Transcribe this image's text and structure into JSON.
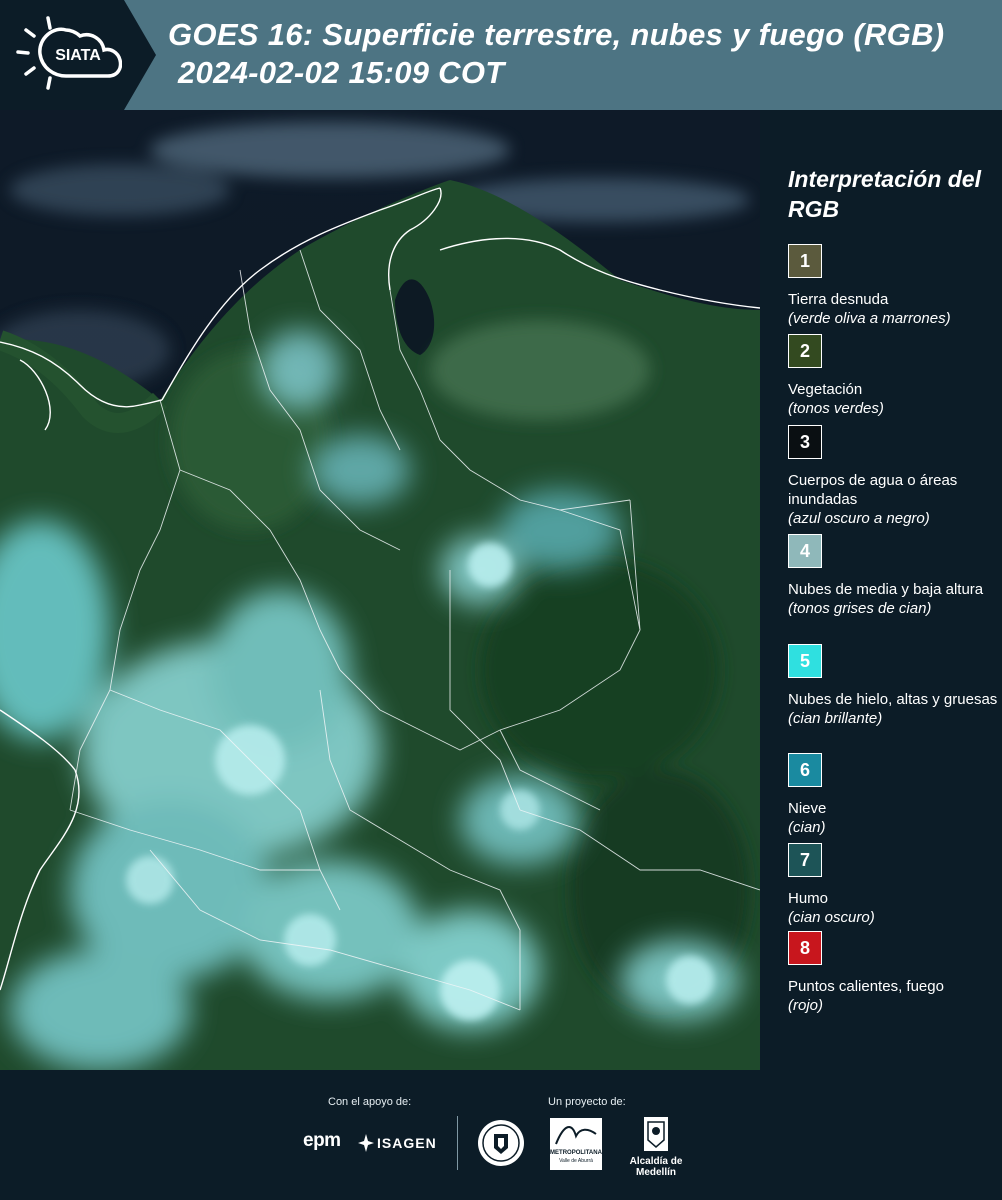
{
  "header": {
    "brand": "SIATA",
    "title_line1": "GOES 16: Superficie terrestre, nubes y fuego (RGB)",
    "title_line2": "2024-02-02 15:09 COT"
  },
  "legend": {
    "title": "Interpretación del RGB",
    "items": [
      {
        "number": "1",
        "label": "Tierra desnuda",
        "sub": "(verde oliva a marrones)",
        "color": "#5b5a3d"
      },
      {
        "number": "2",
        "label": "Vegetación",
        "sub": "(tonos verdes)",
        "color": "#334a20"
      },
      {
        "number": "3",
        "label": "Cuerpos de agua o áreas inundadas",
        "sub": "(azul oscuro a negro)",
        "color": "#0a0f12"
      },
      {
        "number": "4",
        "label": "Nubes de media y baja altura",
        "sub": "(tonos grises de cian)",
        "color": "#8fb8ba"
      },
      {
        "number": "5",
        "label": "Nubes de hielo, altas y gruesas",
        "sub": "(cian brillante)",
        "color": "#2fe0e0"
      },
      {
        "number": "6",
        "label": "Nieve",
        "sub": "(cian)",
        "color": "#1a8aa0"
      },
      {
        "number": "7",
        "label": "Humo",
        "sub": "(cian oscuro)",
        "color": "#1d5457"
      },
      {
        "number": "8",
        "label": "Puntos calientes, fuego",
        "sub": "(rojo)",
        "color": "#c8161d"
      }
    ]
  },
  "footer": {
    "support_label": "Con el apoyo de:",
    "project_label": "Un proyecto de:",
    "epm": "epm",
    "isagen": "ISAGEN",
    "area_name": "METROPOLITANA",
    "area_sub": "Valle de Aburrá",
    "alcaldia": "Alcaldía de Medellín"
  }
}
